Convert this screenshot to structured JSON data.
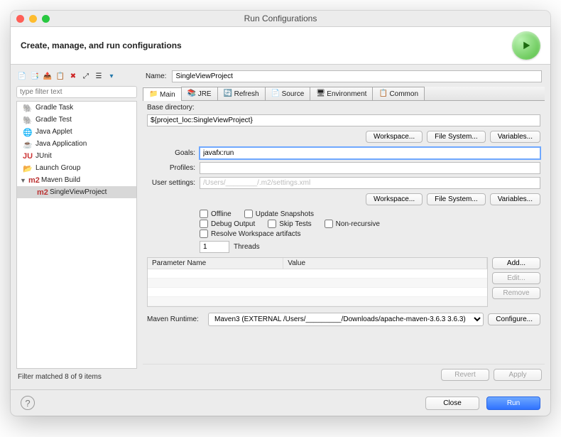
{
  "window": {
    "title": "Run Configurations"
  },
  "header": {
    "subtitle": "Create, manage, and run configurations"
  },
  "sidebar": {
    "filter_placeholder": "type filter text",
    "items": [
      {
        "label": "Gradle Task"
      },
      {
        "label": "Gradle Test"
      },
      {
        "label": "Java Applet"
      },
      {
        "label": "Java Application"
      },
      {
        "label": "JUnit"
      },
      {
        "label": "Launch Group"
      },
      {
        "label": "Maven Build"
      },
      {
        "label": "SingleViewProject"
      }
    ],
    "filter_status": "Filter matched 8 of 9 items"
  },
  "main": {
    "name_label": "Name:",
    "name_value": "SingleViewProject",
    "tabs": [
      "Main",
      "JRE",
      "Refresh",
      "Source",
      "Environment",
      "Common"
    ],
    "base_dir_label": "Base directory:",
    "base_dir_value": "${project_loc:SingleViewProject}",
    "btn_workspace": "Workspace...",
    "btn_filesystem": "File System...",
    "btn_variables": "Variables...",
    "goals_label": "Goals:",
    "goals_value": "javafx:run",
    "profiles_label": "Profiles:",
    "profiles_value": "",
    "usersettings_label": "User settings:",
    "usersettings_value": "/Users/________/.m2/settings.xml",
    "chk_offline": "Offline",
    "chk_update": "Update Snapshots",
    "chk_debug": "Debug Output",
    "chk_skip": "Skip Tests",
    "chk_nonrec": "Non-recursive",
    "chk_resolve": "Resolve Workspace artifacts",
    "threads_value": "1",
    "threads_label": "Threads",
    "param_header_name": "Parameter Name",
    "param_header_value": "Value",
    "btn_add": "Add...",
    "btn_edit": "Edit...",
    "btn_remove": "Remove",
    "runtime_label": "Maven Runtime:",
    "runtime_value": "Maven3 (EXTERNAL /Users/_________/Downloads/apache-maven-3.6.3 3.6.3)",
    "btn_configure": "Configure...",
    "btn_revert": "Revert",
    "btn_apply": "Apply"
  },
  "footer": {
    "btn_close": "Close",
    "btn_run": "Run"
  }
}
